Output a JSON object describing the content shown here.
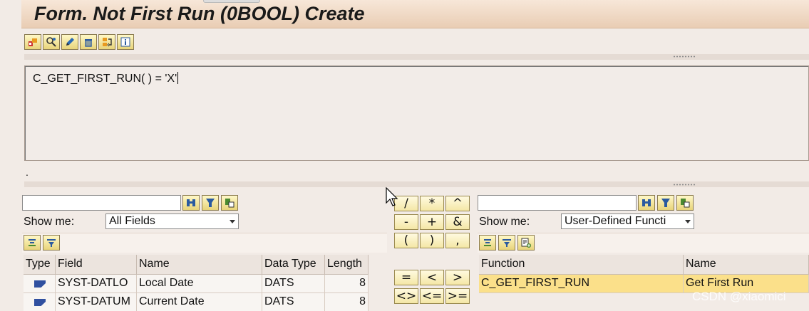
{
  "title": "Form. Not First Run (0BOOL) Create",
  "toolbar": {
    "icons": [
      "check-syntax-icon",
      "settings-icon",
      "edit-icon",
      "delete-icon",
      "replace-icon",
      "info-icon"
    ]
  },
  "editor": {
    "code": "C_GET_FIRST_RUN( ) = 'X'"
  },
  "status_dot": ".",
  "left_panel": {
    "search_value": "",
    "show_me_label": "Show me:",
    "show_me_value": "All Fields",
    "columns": [
      "Type",
      "Field",
      "Name",
      "Data Type",
      "Length"
    ],
    "rows": [
      {
        "field": "SYST-DATLO",
        "name": "Local Date",
        "data_type": "DATS",
        "length": "8"
      },
      {
        "field": "SYST-DATUM",
        "name": "Current Date",
        "data_type": "DATS",
        "length": "8"
      }
    ]
  },
  "operators": {
    "row1": [
      "/",
      "*",
      "^"
    ],
    "row2": [
      "-",
      "+",
      "&"
    ],
    "row3": [
      "(",
      ")",
      ","
    ],
    "row4": [
      "=",
      "<",
      ">"
    ],
    "row5": [
      "<>",
      "<=",
      ">="
    ]
  },
  "right_panel": {
    "search_value": "",
    "show_me_label": "Show me:",
    "show_me_value": "User-Defined Functi",
    "columns": [
      "Function",
      "Name"
    ],
    "rows": [
      {
        "function": "C_GET_FIRST_RUN",
        "name": "Get First Run"
      }
    ]
  },
  "watermark": "CSDN @xiaomici",
  "colors": {
    "accent_yellow": "#fbe08a",
    "title_bg": "#e9cdb4",
    "background": "#f2ebe6"
  }
}
